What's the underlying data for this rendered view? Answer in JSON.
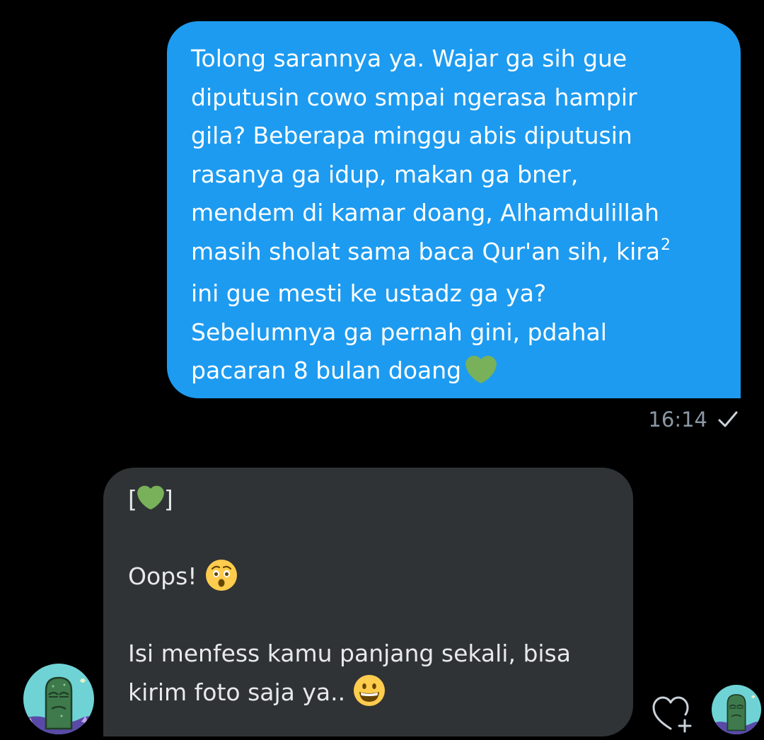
{
  "outgoing_message": {
    "lines": [
      "Tolong sarannya ya. Wajar ga sih gue",
      "diputusin cowo smpai ngerasa hampir",
      "gila? Beberapa minggu abis diputusin",
      "rasanya ga idup, makan ga bner,",
      "mendem di kamar doang, Alhamdulillah",
      "masih sholat sama baca Qur'an sih, kira",
      "ini gue mesti ke ustadz ga ya?",
      "Sebelumnya ga pernah gini, pdahal",
      "pacaran 8 bulan doang"
    ],
    "superscript": "2",
    "trailing_icon": "green-heart-emoji",
    "timestamp": "16:14",
    "status_icon": "check-icon",
    "bubble_color": "#1d9bf0"
  },
  "incoming_message": {
    "bracket_open": "[",
    "bracket_close": "]",
    "bracket_icon": "green-heart-emoji",
    "line_oops": "Oops!",
    "oops_icon": "astonished-face-emoji",
    "line_1": "Isi menfess kamu panjang sekali, bisa",
    "line_2": "kirim foto saja ya..",
    "line_2_icon": "grinning-face-emoji",
    "bubble_color": "#2f3336"
  },
  "controls": {
    "react_icon": "heart-plus-icon"
  },
  "avatars": {
    "left": "avatar-cartoon",
    "right": "avatar-cartoon"
  },
  "colors": {
    "background": "#000000",
    "accent": "#1d9bf0",
    "timestamp": "#8b98a5",
    "heart_green": "#78b159"
  }
}
